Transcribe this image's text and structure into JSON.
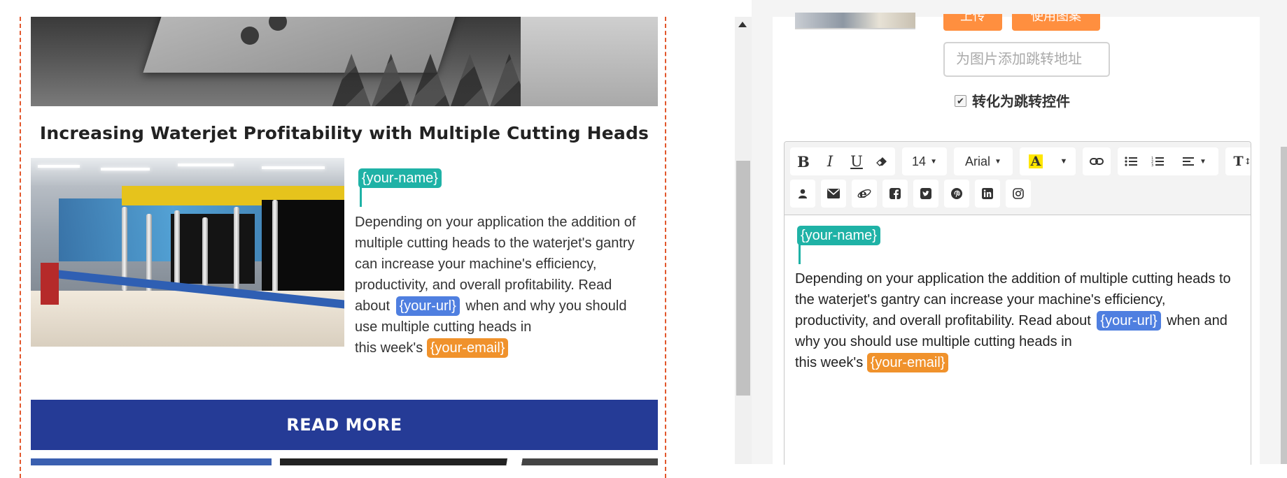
{
  "article": {
    "title": "Increasing Waterjet Profitability with Multiple Cutting Heads",
    "tag_name": "{your-name}",
    "body_part1": "Depending on your application the addition of multiple cutting heads to the waterjet's gantry can increase your machine's efficiency, productivity, and overall profitability. Read about ",
    "tag_url": "{your-url}",
    "body_part2": " when and why you should use multiple cutting heads in",
    "body_part3": "this week's ",
    "tag_email": "{your-email}",
    "read_more": "READ MORE"
  },
  "editor": {
    "upload_label": "上传",
    "use_icon_label": "使用图案",
    "link_placeholder": "为图片添加跳转地址",
    "convert_label": "转化为跳转控件",
    "toolbar": {
      "font_size": "14",
      "font_family": "Arial"
    }
  },
  "colors": {
    "tag_teal": "#1fb2a6",
    "tag_blue": "#4f7fe0",
    "tag_orange": "#f0922c",
    "read_more_bg": "#253b96",
    "orange_button": "#ff8f3f",
    "frame_dash": "#e2572c"
  }
}
